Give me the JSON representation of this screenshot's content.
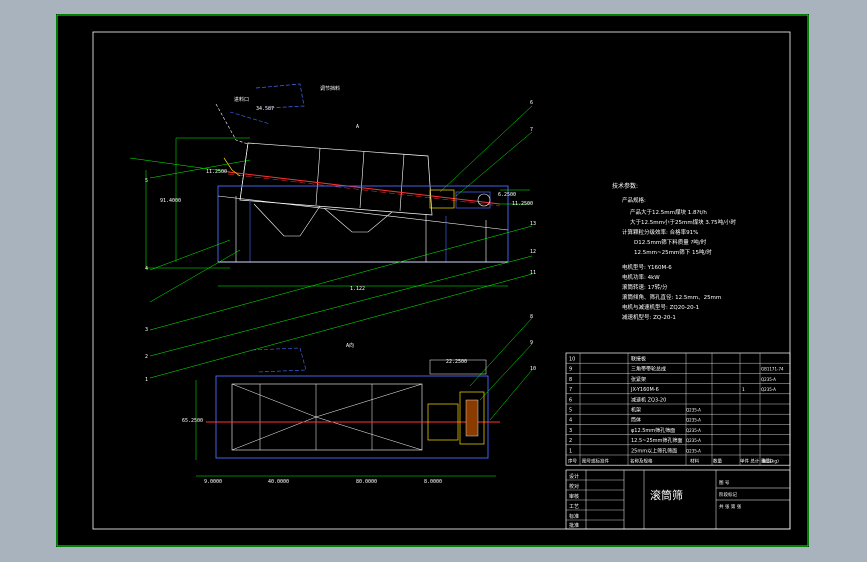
{
  "drawing": {
    "title": "滚筒筛",
    "legend_title": "技术参数:",
    "params": [
      "产品规格:",
      "产品大于12.5mm煤块 1.8?t/h",
      "大于12.5mm小于25mm煤块 3.75吨/小时",
      "计算颗粒分级效率: 合格率91%",
      "D12.5mm筛下料质量 ?吨/时",
      "12.5mm~25mm筛下 15吨/时",
      "电机型号: Y160M-6",
      "电机功率: 4kW",
      "滚筒转速: 17转/分",
      "滚筒倾角、筛孔直径: 12.5mm、25mm",
      "电机与减速机型号: ZQ20-20-1",
      "减速机型号: ZQ-20-1"
    ],
    "annotations": {
      "feed": "进料口",
      "discharge": "调节挡料",
      "angle": "34.587",
      "view_a": "A",
      "view_label": "A向",
      "d1": "11.2500",
      "d2": "11.2500",
      "d3": "91.4000",
      "d4": "6.2500",
      "d5": "11.2500",
      "d6": "1.122",
      "d7": "65.2500",
      "d8": "9.0000",
      "d9": "40.0000",
      "d10": "80.0000",
      "d11": "8.0000",
      "d12": "22.2500"
    },
    "balloons": [
      "6",
      "7",
      "8",
      "9",
      "10",
      "11",
      "12",
      "13",
      "1",
      "2",
      "3",
      "4",
      "5"
    ],
    "bom_rows": [
      {
        "no": "10",
        "name": "联接板",
        "qty": "",
        "mat": "",
        "note": ""
      },
      {
        "no": "9",
        "name": "三角带带轮总成",
        "qty": "",
        "mat": "",
        "note": "GB1171-74"
      },
      {
        "no": "8",
        "name": "张紧架",
        "qty": "",
        "mat": "",
        "note": "Q235-A"
      },
      {
        "no": "7",
        "name": "JX-Y160M-6",
        "name2": "电机",
        "qty": "1",
        "mat": "",
        "note": "Q235-A"
      },
      {
        "no": "6",
        "name": "减速机 ZQ3-20",
        "qty": "",
        "mat": "",
        "note": ""
      },
      {
        "no": "5",
        "name": "机架",
        "qty": "",
        "mat": "Q235-A",
        "note": ""
      },
      {
        "no": "4",
        "name": "筒体",
        "qty": "",
        "mat": "Q235-A",
        "note": ""
      },
      {
        "no": "3",
        "name": "φ12.5mm筛孔筛面",
        "qty": "",
        "mat": "Q235-A",
        "note": ""
      },
      {
        "no": "2",
        "name": "12.5~25mm筛孔筛面",
        "qty": "",
        "mat": "Q235-A",
        "note": ""
      },
      {
        "no": "1",
        "name": "25mm以上筛孔筛面",
        "qty": "",
        "mat": "Q235-A",
        "note": ""
      }
    ],
    "bom_header": {
      "no": "序号",
      "drawing": "图号或标准件",
      "name": "名称及规格",
      "qty": "数量",
      "mat": "材料",
      "weight": "单件 总计 重量(kg)",
      "note": "备 注"
    },
    "title_block": {
      "rows": [
        "设计",
        "校对",
        "审核",
        "工艺",
        "标准",
        "批准"
      ],
      "stage": "阶段标记",
      "weight": "重量",
      "scale": "比例",
      "sheet": "共 张 第 张",
      "org": "图 号"
    }
  }
}
